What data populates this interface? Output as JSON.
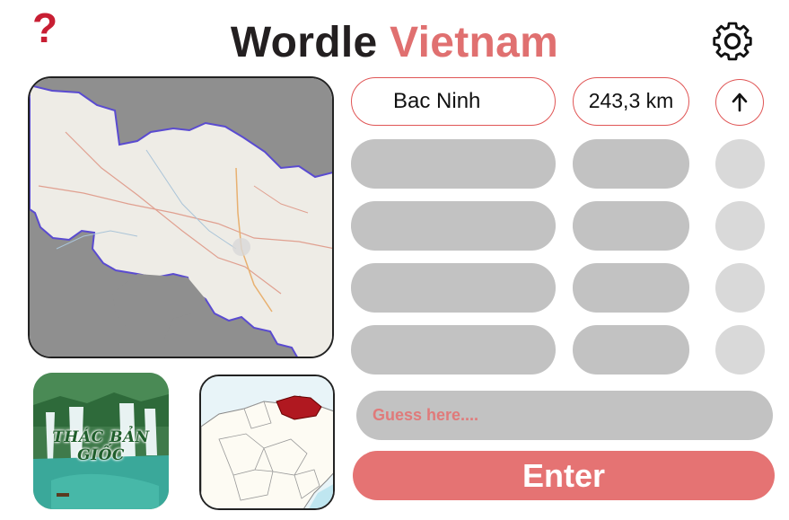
{
  "header": {
    "help_symbol": "?",
    "title_main": "Wordle",
    "title_accent": "Vietnam"
  },
  "icons": {
    "help": "question-mark-icon",
    "settings": "gear-icon",
    "direction": "arrow-up-icon"
  },
  "colors": {
    "accent": "#e07070",
    "help": "#c81e33",
    "pill_empty": "#c2c2c2",
    "dot_empty": "#d9d9d9",
    "enter": "#e57373"
  },
  "guesses": [
    {
      "province": "Bac Ninh",
      "distance": "243,3 km",
      "direction": "up"
    }
  ],
  "thumbnail": {
    "label": "THÁC BẢN GIỐC"
  },
  "input": {
    "placeholder": "Guess here....",
    "value": ""
  },
  "enter_label": "Enter"
}
